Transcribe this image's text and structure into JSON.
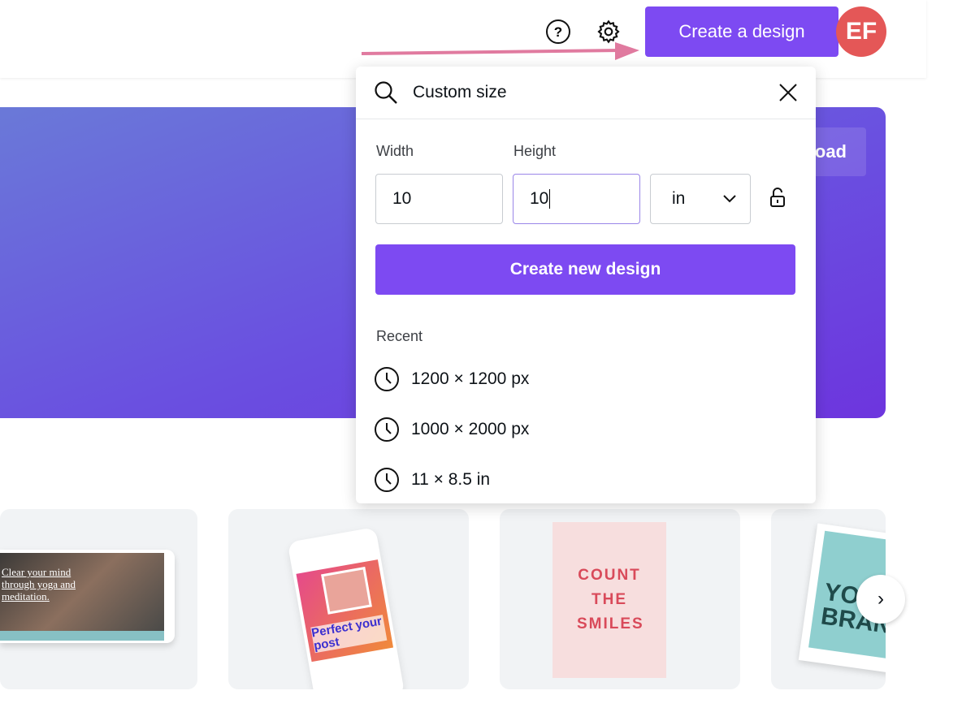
{
  "header": {
    "create_label": "Create a design",
    "avatar_initials": "EF",
    "help_icon": "help-circle-icon",
    "settings_icon": "gear-icon"
  },
  "hero": {
    "upload_label": "oad"
  },
  "popup": {
    "search_value": "Custom size",
    "width_label": "Width",
    "height_label": "Height",
    "width_value": "10",
    "height_value": "10",
    "unit_value": "in",
    "create_label": "Create new design",
    "recent_label": "Recent",
    "recent": [
      "1200 × 1200 px",
      "1000 × 2000 px",
      "11 × 8.5 in"
    ]
  },
  "templates": [
    {
      "text": "Clear your mind through yoga and meditation."
    },
    {
      "text": "Perfect your post"
    },
    {
      "text": "COUNT THE SMILES"
    },
    {
      "text": "YO BRAN"
    }
  ],
  "colors": {
    "accent": "#7d4af2",
    "avatar": "#e45757",
    "arrow": "#e07a9f"
  }
}
